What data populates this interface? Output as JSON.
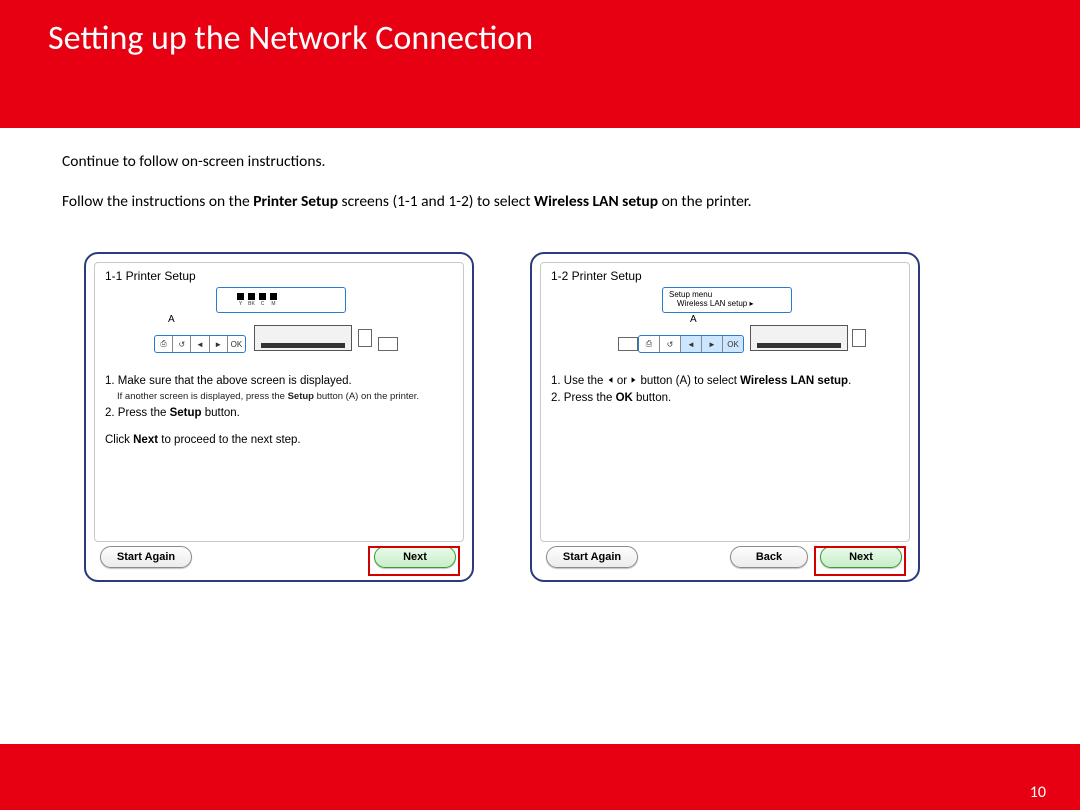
{
  "header": {
    "title": "Setting up the Network Connection"
  },
  "footer": {
    "page": "10"
  },
  "intro": {
    "line1": "Continue to follow on-screen instructions.",
    "line2_prefix": "Follow the instructions on the ",
    "line2_bold1": "Printer Setup",
    "line2_mid": " screens (1-1 and 1-2) to select ",
    "line2_bold2": "Wireless LAN setup",
    "line2_suffix": " on the printer."
  },
  "screen1": {
    "title": "1-1 Printer Setup",
    "ink_labels": [
      "Y",
      "BK",
      "C",
      "M"
    ],
    "a_label": "A",
    "panel_buttons": [
      "⎙",
      "↺",
      "◄",
      "►",
      "OK"
    ],
    "instr_1_prefix": "1. Make sure that the above screen is displayed.",
    "instr_1_sub_prefix": "If another screen is displayed, press the ",
    "instr_1_sub_bold": "Setup",
    "instr_1_sub_suffix": " button (A) on the printer.",
    "instr_2_prefix": "2. Press the ",
    "instr_2_bold": "Setup",
    "instr_2_suffix": " button.",
    "instr_3_prefix": "Click ",
    "instr_3_bold": "Next",
    "instr_3_suffix": " to proceed to the next step.",
    "buttons": {
      "start_again": "Start Again",
      "next": "Next"
    }
  },
  "screen2": {
    "title": "1-2 Printer Setup",
    "lcd_line1": "Setup menu",
    "lcd_line2": "Wireless LAN setup  ▸",
    "a_label": "A",
    "panel_buttons": [
      "⎙",
      "↺",
      "◄",
      "►",
      "OK"
    ],
    "instr_1_prefix": "1. Use the ",
    "instr_1_mid": " or ",
    "instr_1_after": " button (A) to select ",
    "instr_1_bold": "Wireless LAN setup",
    "instr_1_suffix": ".",
    "instr_2_prefix": "2. Press the ",
    "instr_2_bold": "OK",
    "instr_2_suffix": " button.",
    "buttons": {
      "start_again": "Start Again",
      "back": "Back",
      "next": "Next"
    }
  }
}
